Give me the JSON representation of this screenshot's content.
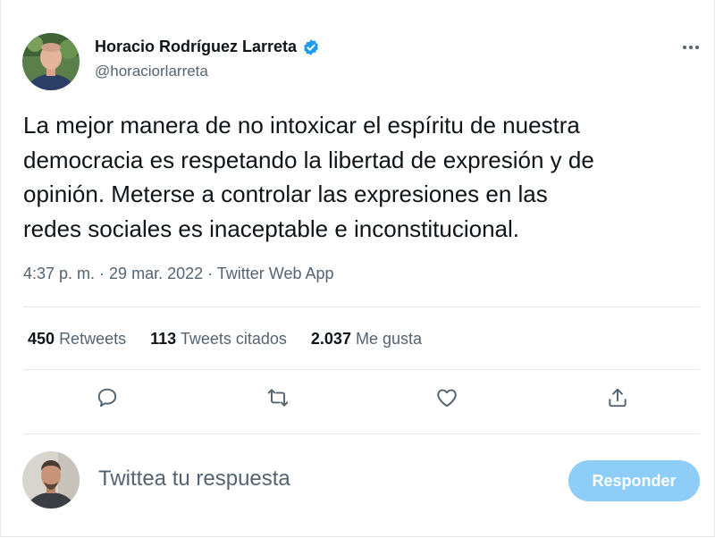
{
  "author": {
    "name": "Horacio Rodríguez Larreta",
    "handle": "@horaciorlarreta",
    "verified": true
  },
  "tweet": {
    "text_lines": [
      "La mejor manera de no intoxicar el espíritu de nuestra",
      "democracia es respetando la libertad de expresión y de",
      "opinión. Meterse a controlar las expresiones en las",
      "redes sociales es inaceptable e inconstitucional."
    ],
    "time": "4:37 p. m.",
    "date": "29 mar. 2022",
    "source": "Twitter Web App"
  },
  "stats": {
    "retweets_count": "450",
    "retweets_label": "Retweets",
    "quotes_count": "113",
    "quotes_label": "Tweets citados",
    "likes_count": "2.037",
    "likes_label": "Me gusta"
  },
  "reply": {
    "placeholder": "Twittea tu respuesta",
    "button_label": "Responder"
  },
  "icons": {
    "verified": "verified-badge-icon",
    "more": "more-dots-icon",
    "reply": "reply-bubble-icon",
    "retweet": "retweet-icon",
    "like": "heart-icon",
    "share": "share-icon"
  },
  "colors": {
    "verified_blue": "#1d9bf0",
    "secondary_text": "#536471",
    "button_disabled": "#8ecdf8"
  }
}
